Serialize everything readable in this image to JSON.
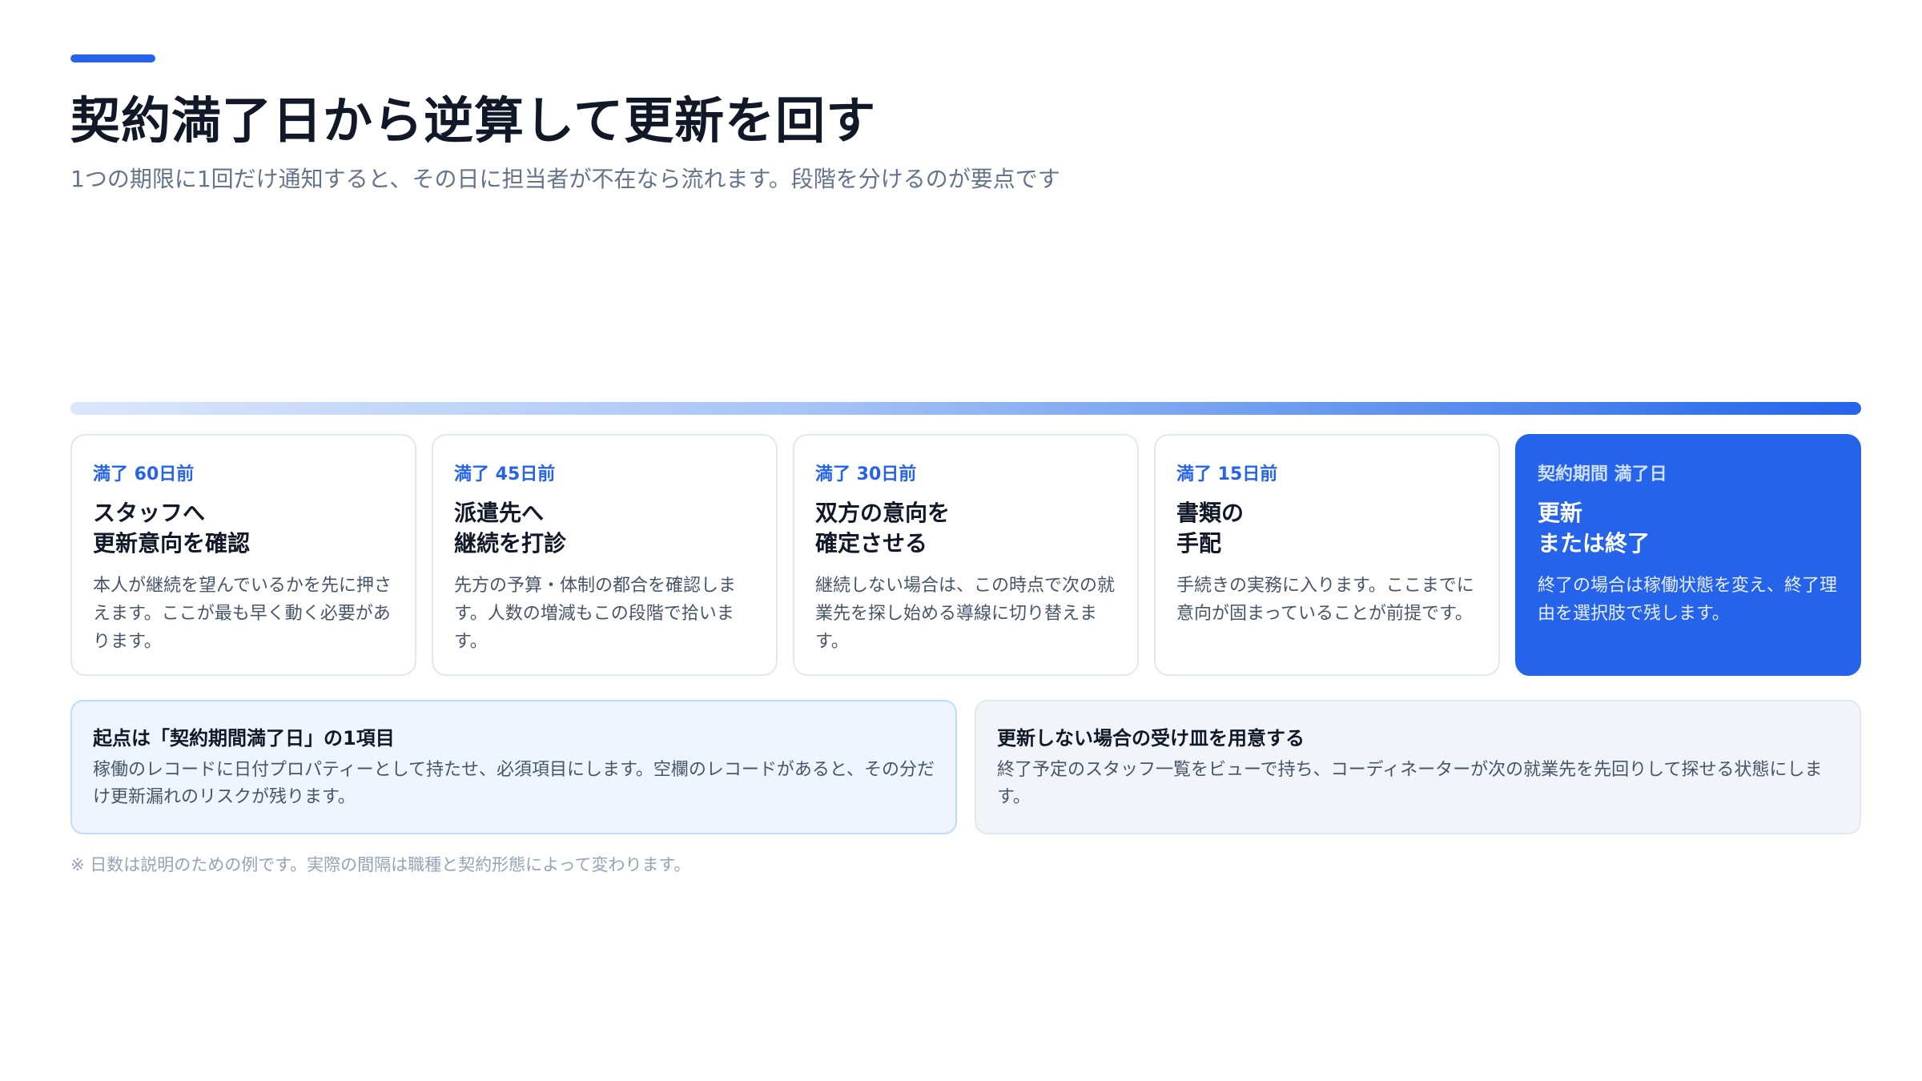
{
  "header": {
    "title": "契約満了日から逆算して更新を回す",
    "subtitle": "1つの期限に1回だけ通知すると、その日に担当者が不在なら流れます。段階を分けるのが要点です"
  },
  "steps": [
    {
      "label": "満了 60日前",
      "title_line1": "スタッフへ",
      "title_line2": "更新意向を確認",
      "description": "本人が継続を望んでいるかを先に押さえます。ここが最も早く動く必要があります。"
    },
    {
      "label": "満了 45日前",
      "title_line1": "派遣先へ",
      "title_line2": "継続を打診",
      "description": "先方の予算・体制の都合を確認します。人数の増減もこの段階で拾います。"
    },
    {
      "label": "満了 30日前",
      "title_line1": "双方の意向を",
      "title_line2": "確定させる",
      "description": "継続しない場合は、この時点で次の就業先を探し始める導線に切り替えます。"
    },
    {
      "label": "満了 15日前",
      "title_line1": "書類の",
      "title_line2": "手配",
      "description": "手続きの実務に入ります。ここまでに意向が固まっていることが前提です。"
    },
    {
      "label": "契約期間 満了日",
      "title_line1": "更新",
      "title_line2": "または終了",
      "description": "終了の場合は稼働状態を変え、終了理由を選択肢で残します。"
    }
  ],
  "notes": {
    "left": {
      "title": "起点は「契約期間満了日」の1項目",
      "text": "稼働のレコードに日付プロパティーとして持たせ、必須項目にします。空欄のレコードがあると、その分だけ更新漏れのリスクが残ります。"
    },
    "right": {
      "title": "更新しない場合の受け皿を用意する",
      "text": "終了予定のスタッフ一覧をビューで持ち、コーディネーターが次の就業先を先回りして探せる状態にします。"
    }
  },
  "footnote": "※ 日数は説明のための例です。実際の間隔は職種と契約形態によって変わります。",
  "colors": {
    "accent": "#2563eb",
    "title": "#111827",
    "muted": "#64748b",
    "note_left_bg": "#eef5ff",
    "note_right_bg": "#f1f5f9"
  }
}
